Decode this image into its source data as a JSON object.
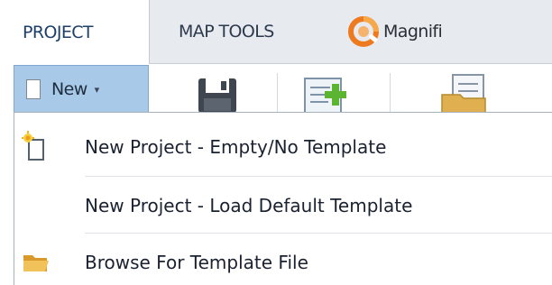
{
  "tabs": {
    "project": "PROJECT",
    "map_tools": "MAP TOOLS",
    "magnifi": "Magnifi"
  },
  "ribbon": {
    "new_label": "New",
    "new_icon": "blank-page-icon",
    "caret": "▾",
    "icons": [
      "save-icon",
      "add-layer-icon",
      "open-folder-icon"
    ]
  },
  "menu": {
    "items": [
      {
        "label": "New Project - Empty/No Template",
        "icon": "new-document-sparkle-icon"
      },
      {
        "label": "New Project - Load Default Template",
        "icon": ""
      },
      {
        "label": "Browse For Template File",
        "icon": "folder-icon"
      }
    ]
  },
  "colors": {
    "tabstrip_bg": "#e7eaee",
    "new_button_bg": "#a8c9e8",
    "logo_orange": "#ee7a1f",
    "folder_yellow": "#f2c25a"
  }
}
